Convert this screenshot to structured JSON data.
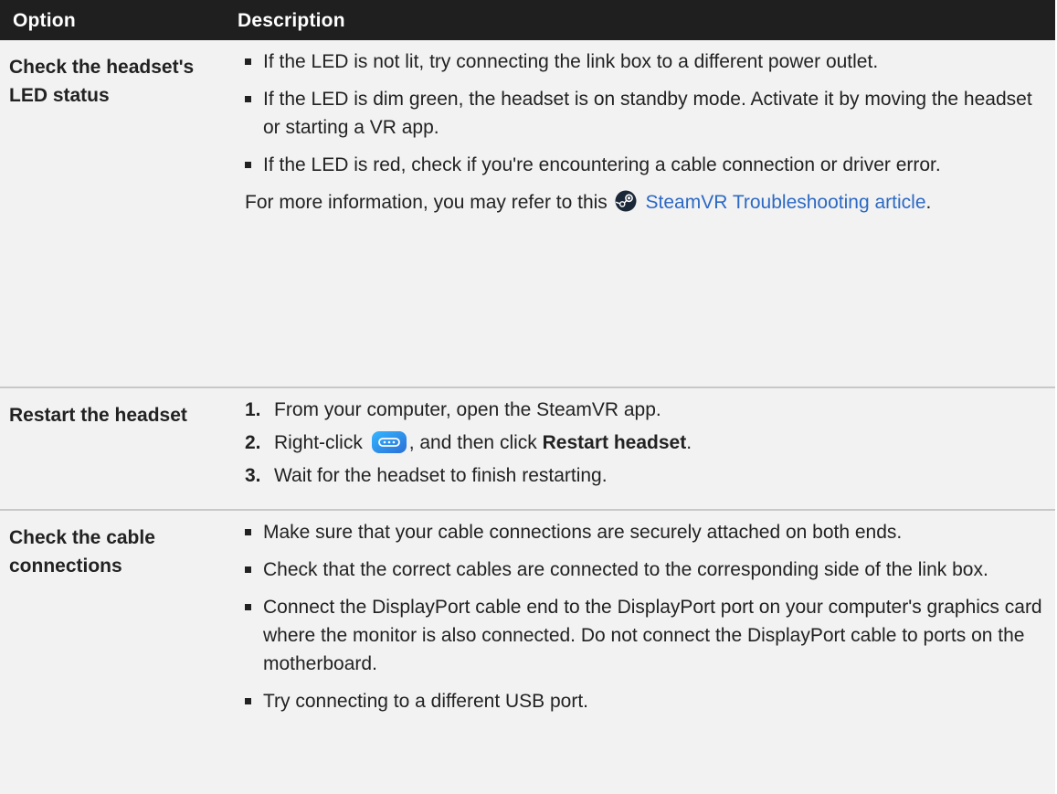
{
  "table": {
    "headers": {
      "option": "Option",
      "description": "Description"
    },
    "rows": [
      {
        "option": "Check the headset's LED status",
        "bullets": [
          "If the LED is not lit, try connecting the link box to a different power outlet.",
          "If the LED is dim green, the headset is on standby mode. Activate it by moving the headset or starting a VR app.",
          "If the LED is red, check if you're encountering a cable connection or driver error."
        ],
        "note_prefix": "For more information, you may refer to this",
        "note_link": "SteamVR Troubleshooting article",
        "note_suffix": "."
      },
      {
        "option": "Restart the headset",
        "steps": [
          {
            "num": "1.",
            "text": "From your computer, open the SteamVR app."
          },
          {
            "num": "2.",
            "text_before": "Right-click",
            "text_middle": ", and then click ",
            "bold": "Restart headset",
            "text_after": "."
          },
          {
            "num": "3.",
            "text": "Wait for the headset to finish restarting."
          }
        ]
      },
      {
        "option": "Check the cable connections",
        "bullets": [
          "Make sure that your cable connections are securely attached on both ends.",
          "Check that the correct cables are connected to the corresponding side of the link box.",
          "Connect the DisplayPort cable end to the DisplayPort port on your computer's graphics card where the monitor is also connected. Do not connect the DisplayPort cable to ports on the motherboard.",
          "Try connecting to a different USB port."
        ]
      }
    ]
  },
  "icons": {
    "steam": "steam-logo-icon",
    "steamvr_headset": "steamvr-headset-icon"
  },
  "colors": {
    "header_bg": "#1f1f1f",
    "row_bg": "#f2f2f2",
    "link": "#2c69c4",
    "divider": "#c8c8c8"
  }
}
